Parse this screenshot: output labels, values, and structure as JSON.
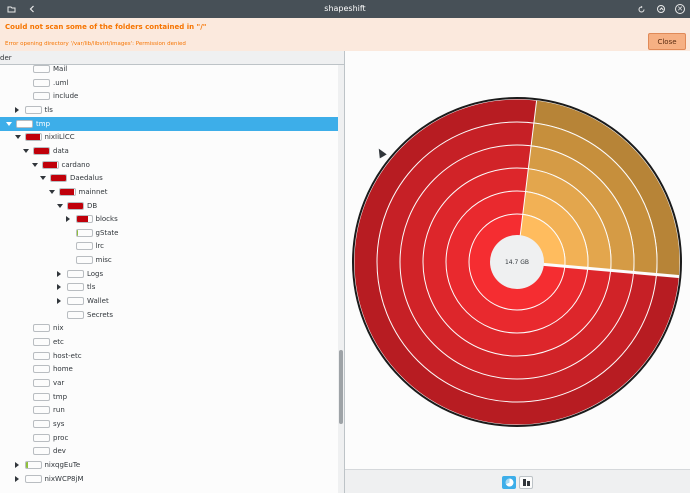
{
  "window": {
    "title": "shapeshift"
  },
  "banner": {
    "title": "Could not scan some of the folders contained in \"/\"",
    "message": "Error opening directory '/var/lib/libvirt/images': Permission denied",
    "close_label": "Close"
  },
  "tree": {
    "column_header": "der",
    "rows": [
      {
        "name": "Mail",
        "depth": 2,
        "expander": "none",
        "fraction": 0,
        "color": ""
      },
      {
        "name": ".uml",
        "depth": 2,
        "expander": "none",
        "fraction": 0,
        "color": ""
      },
      {
        "name": "include",
        "depth": 2,
        "expander": "none",
        "fraction": 0,
        "color": ""
      },
      {
        "name": "tls",
        "depth": 1,
        "expander": "closed",
        "fraction": 0,
        "color": ""
      },
      {
        "name": "tmp",
        "depth": 0,
        "expander": "open",
        "fraction": 0.99,
        "color": "#ffffff",
        "selected": true
      },
      {
        "name": "nixIiLlCC",
        "depth": 1,
        "expander": "open",
        "fraction": 0.99,
        "color": "#c0000a"
      },
      {
        "name": "data",
        "depth": 2,
        "expander": "open",
        "fraction": 0.99,
        "color": "#c0000a"
      },
      {
        "name": "cardano",
        "depth": 3,
        "expander": "open",
        "fraction": 0.99,
        "color": "#c0000a"
      },
      {
        "name": "Daedalus",
        "depth": 4,
        "expander": "open",
        "fraction": 0.99,
        "color": "#c0000a"
      },
      {
        "name": "mainnet",
        "depth": 5,
        "expander": "open",
        "fraction": 0.99,
        "color": "#c0000a"
      },
      {
        "name": "DB",
        "depth": 6,
        "expander": "open",
        "fraction": 0.99,
        "color": "#c0000a"
      },
      {
        "name": "blocks",
        "depth": 7,
        "expander": "closed",
        "fraction": 0.75,
        "color": "#c0000a"
      },
      {
        "name": "gState",
        "depth": 7,
        "expander": "none",
        "fraction": 0.12,
        "color": "#8fbf3c"
      },
      {
        "name": "lrc",
        "depth": 7,
        "expander": "none",
        "fraction": 0,
        "color": ""
      },
      {
        "name": "misc",
        "depth": 7,
        "expander": "none",
        "fraction": 0,
        "color": ""
      },
      {
        "name": "Logs",
        "depth": 6,
        "expander": "closed",
        "fraction": 0,
        "color": ""
      },
      {
        "name": "tls",
        "depth": 6,
        "expander": "closed",
        "fraction": 0,
        "color": ""
      },
      {
        "name": "Wallet",
        "depth": 6,
        "expander": "closed",
        "fraction": 0,
        "color": ""
      },
      {
        "name": "Secrets",
        "depth": 6,
        "expander": "none",
        "fraction": 0,
        "color": ""
      },
      {
        "name": "nix",
        "depth": 2,
        "expander": "none",
        "fraction": 0,
        "color": ""
      },
      {
        "name": "etc",
        "depth": 2,
        "expander": "none",
        "fraction": 0,
        "color": ""
      },
      {
        "name": "host-etc",
        "depth": 2,
        "expander": "none",
        "fraction": 0,
        "color": ""
      },
      {
        "name": "home",
        "depth": 2,
        "expander": "none",
        "fraction": 0,
        "color": ""
      },
      {
        "name": "var",
        "depth": 2,
        "expander": "none",
        "fraction": 0,
        "color": ""
      },
      {
        "name": "tmp",
        "depth": 2,
        "expander": "none",
        "fraction": 0,
        "color": ""
      },
      {
        "name": "run",
        "depth": 2,
        "expander": "none",
        "fraction": 0,
        "color": ""
      },
      {
        "name": "sys",
        "depth": 2,
        "expander": "none",
        "fraction": 0,
        "color": ""
      },
      {
        "name": "proc",
        "depth": 2,
        "expander": "none",
        "fraction": 0,
        "color": ""
      },
      {
        "name": "dev",
        "depth": 2,
        "expander": "none",
        "fraction": 0,
        "color": ""
      },
      {
        "name": "nixqgEuTe",
        "depth": 1,
        "expander": "closed",
        "fraction": 0.15,
        "color": "#8fbf3c"
      },
      {
        "name": "nixWCP8jM",
        "depth": 1,
        "expander": "closed",
        "fraction": 0,
        "color": ""
      }
    ]
  },
  "chart": {
    "center_label": "14.7 GB",
    "segment_split_fraction": 0.245
  },
  "colors": {
    "accent": "#3daee9",
    "warning": "#f67400",
    "red_ring": [
      "#b71c22",
      "#c62026",
      "#d12328",
      "#dd262b",
      "#e9292e",
      "#f52d31"
    ],
    "orange_ring": [
      "#b78437",
      "#c68f3c",
      "#d59b45",
      "#e3a64d",
      "#f2b155",
      "#ffbc5e"
    ]
  },
  "footer": {
    "chart_view_icon": "ring-chart-icon",
    "bar_view_icon": "bar-chart-icon"
  }
}
